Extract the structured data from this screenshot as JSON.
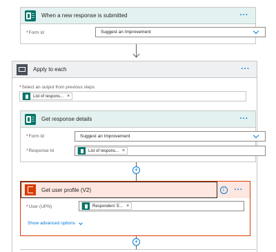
{
  "trigger": {
    "title": "When a new response is submitted",
    "more_label": "···",
    "field": {
      "label": "Form Id",
      "required_mark": "*",
      "value": "Suggest an Improvement"
    }
  },
  "apply_each": {
    "title": "Apply to each",
    "more_label": "···",
    "select_label": "Select an output from previous steps",
    "required_mark": "*",
    "token": "List of respons...",
    "token_remove": "×"
  },
  "get_response": {
    "title": "Get response details",
    "more_label": "···",
    "form_id": {
      "label": "Form Id",
      "required_mark": "*",
      "value": "Suggest an Improvement"
    },
    "response_id": {
      "label": "Response Id",
      "required_mark": "*",
      "token": "List of respons...",
      "token_remove": "×"
    }
  },
  "get_user": {
    "title": "Get user profile (V2)",
    "info_icon": "info-icon",
    "more_label": "···",
    "user_upn": {
      "label": "User (UPN)",
      "required_mark": "*",
      "token": "Responders' E...",
      "token_remove": "×"
    },
    "advanced": "Show advanced options"
  },
  "add_step": "+",
  "colors": {
    "accent": "#0078d4",
    "forms": "#077568",
    "office": "#d83b01",
    "selected_bg": "#fde7e0"
  }
}
